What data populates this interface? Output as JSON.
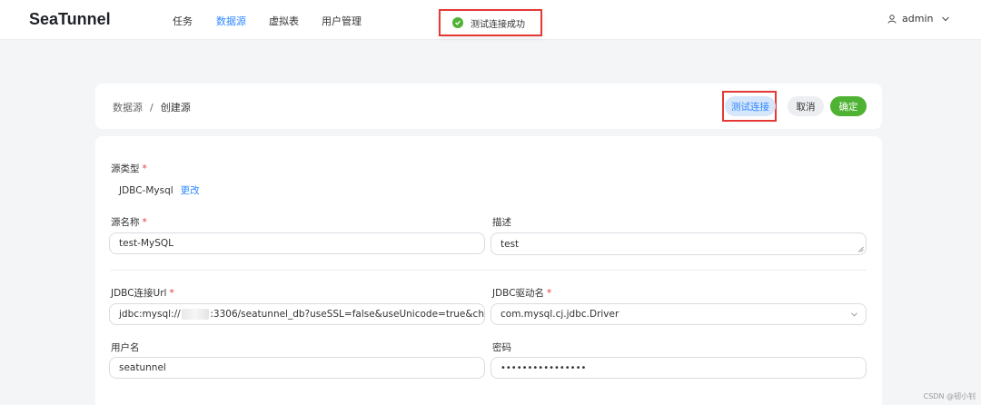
{
  "app": {
    "logo": "SeaTunnel"
  },
  "nav": {
    "items": [
      "任务",
      "数据源",
      "虚拟表",
      "用户管理"
    ]
  },
  "user": {
    "name": "admin"
  },
  "toast": {
    "text": "测试连接成功"
  },
  "breadcrumb": {
    "parent": "数据源",
    "separator": "/",
    "current": "创建源"
  },
  "actions": {
    "test_label": "测试连接",
    "cancel_label": "取消",
    "ok_label": "确定"
  },
  "form": {
    "source_type": {
      "label": "源类型",
      "value": "JDBC-Mysql",
      "change_link": "更改"
    },
    "source_name": {
      "label": "源名称",
      "value": "test-MySQL"
    },
    "description": {
      "label": "描述",
      "value": "test"
    },
    "jdbc_url": {
      "label": "JDBC连接Url",
      "value_prefix": "jdbc:mysql://",
      "value_suffix": ":3306/seatunnel_db?useSSL=false&useUnicode=true&ch"
    },
    "jdbc_driver": {
      "label": "JDBC驱动名",
      "value": "com.mysql.cj.jdbc.Driver"
    },
    "username": {
      "label": "用户名",
      "value": "seatunnel"
    },
    "password": {
      "label": "密码",
      "value": "••••••••••••••••"
    }
  },
  "watermark": "CSDN @韧小钊",
  "colors": {
    "accent": "#2f88ff",
    "success": "#4fb233",
    "highlight_box": "#e53935"
  }
}
